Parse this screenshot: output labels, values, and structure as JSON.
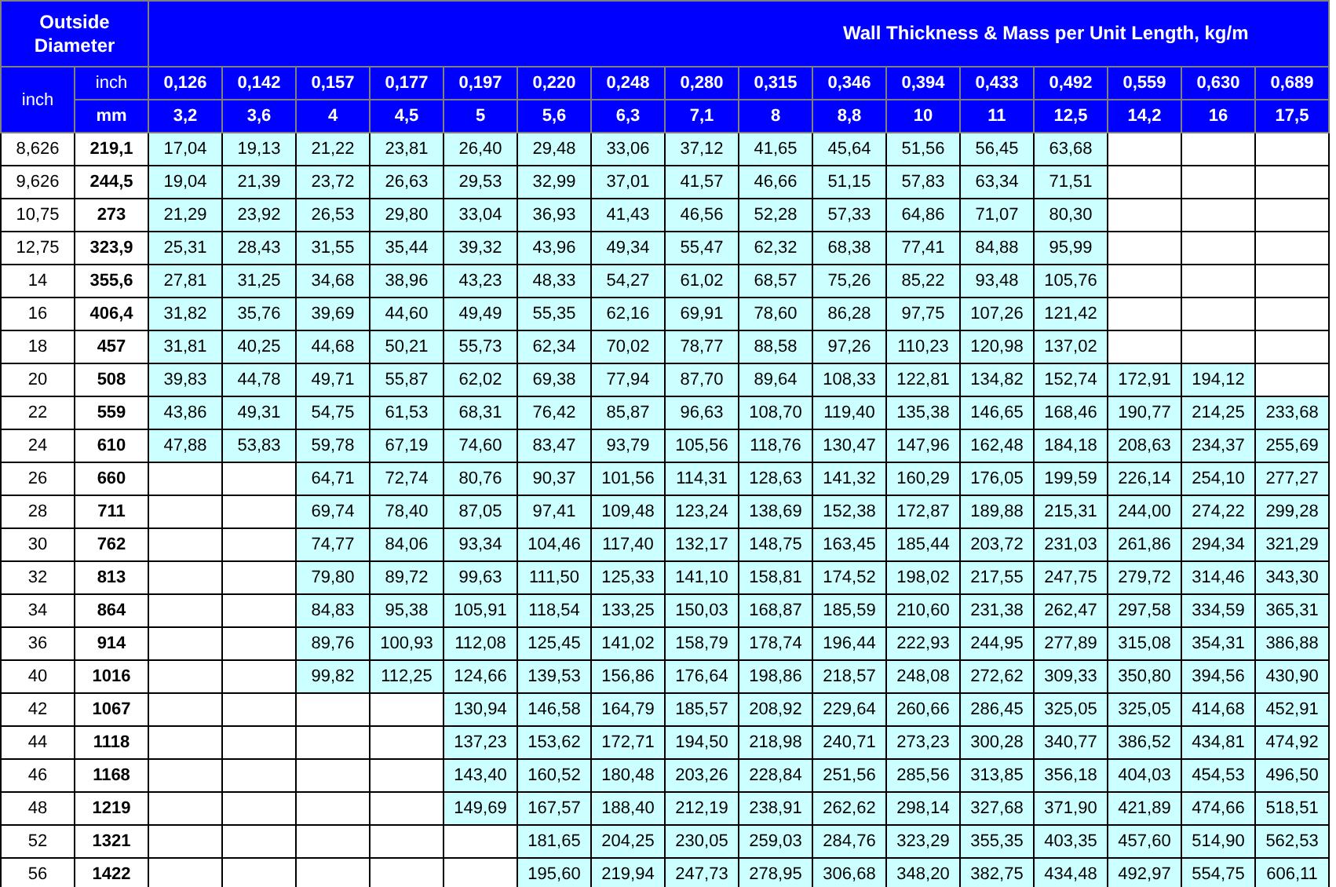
{
  "table": {
    "od_header": "Outside Diameter",
    "wt_header": "Wall Thickness & Mass per Unit Length, kg/m",
    "od_inch_label": "inch",
    "wt_inch_label": "inch",
    "wt_mm_label": "mm",
    "thicknesses": [
      {
        "inch": "0,126",
        "mm": "3,2"
      },
      {
        "inch": "0,142",
        "mm": "3,6"
      },
      {
        "inch": "0,157",
        "mm": "4"
      },
      {
        "inch": "0,177",
        "mm": "4,5"
      },
      {
        "inch": "0,197",
        "mm": "5"
      },
      {
        "inch": "0,220",
        "mm": "5,6"
      },
      {
        "inch": "0,248",
        "mm": "6,3"
      },
      {
        "inch": "0,280",
        "mm": "7,1"
      },
      {
        "inch": "0,315",
        "mm": "8"
      },
      {
        "inch": "0,346",
        "mm": "8,8"
      },
      {
        "inch": "0,394",
        "mm": "10"
      },
      {
        "inch": "0,433",
        "mm": "11"
      },
      {
        "inch": "0,492",
        "mm": "12,5"
      },
      {
        "inch": "0,559",
        "mm": "14,2"
      },
      {
        "inch": "0,630",
        "mm": "16"
      },
      {
        "inch": "0,689",
        "mm": "17,5"
      }
    ],
    "rows": [
      {
        "inch": "8,626",
        "mm": "219,1",
        "cells": [
          {
            "kind": "value",
            "text": "17,04"
          },
          {
            "kind": "value",
            "text": "19,13"
          },
          {
            "kind": "value",
            "text": "21,22"
          },
          {
            "kind": "value",
            "text": "23,81"
          },
          {
            "kind": "value",
            "text": "26,40"
          },
          {
            "kind": "value",
            "text": "29,48"
          },
          {
            "kind": "value",
            "text": "33,06"
          },
          {
            "kind": "value",
            "text": "37,12"
          },
          {
            "kind": "value",
            "text": "41,65"
          },
          {
            "kind": "value",
            "text": "45,64"
          },
          {
            "kind": "value",
            "text": "51,56"
          },
          {
            "kind": "value",
            "text": "56,45"
          },
          {
            "kind": "value",
            "text": "63,68"
          },
          {
            "kind": "blank"
          },
          {
            "kind": "blank"
          },
          {
            "kind": "blank"
          }
        ]
      },
      {
        "inch": "9,626",
        "mm": "244,5",
        "cells": [
          {
            "kind": "value",
            "text": "19,04"
          },
          {
            "kind": "value",
            "text": "21,39"
          },
          {
            "kind": "value",
            "text": "23,72"
          },
          {
            "kind": "value",
            "text": "26,63"
          },
          {
            "kind": "value",
            "text": "29,53"
          },
          {
            "kind": "value",
            "text": "32,99"
          },
          {
            "kind": "value",
            "text": "37,01"
          },
          {
            "kind": "value",
            "text": "41,57"
          },
          {
            "kind": "value",
            "text": "46,66"
          },
          {
            "kind": "value",
            "text": "51,15"
          },
          {
            "kind": "value",
            "text": "57,83"
          },
          {
            "kind": "value",
            "text": "63,34"
          },
          {
            "kind": "value",
            "text": "71,51"
          },
          {
            "kind": "blank"
          },
          {
            "kind": "blank"
          },
          {
            "kind": "blank"
          }
        ]
      },
      {
        "inch": "10,75",
        "mm": "273",
        "cells": [
          {
            "kind": "value",
            "text": "21,29"
          },
          {
            "kind": "value",
            "text": "23,92"
          },
          {
            "kind": "value",
            "text": "26,53"
          },
          {
            "kind": "value",
            "text": "29,80"
          },
          {
            "kind": "value",
            "text": "33,04"
          },
          {
            "kind": "value",
            "text": "36,93"
          },
          {
            "kind": "value",
            "text": "41,43"
          },
          {
            "kind": "value",
            "text": "46,56"
          },
          {
            "kind": "value",
            "text": "52,28"
          },
          {
            "kind": "value",
            "text": "57,33"
          },
          {
            "kind": "value",
            "text": "64,86"
          },
          {
            "kind": "value",
            "text": "71,07"
          },
          {
            "kind": "value",
            "text": "80,30"
          },
          {
            "kind": "blank"
          },
          {
            "kind": "blank"
          },
          {
            "kind": "blank"
          }
        ]
      },
      {
        "inch": "12,75",
        "mm": "323,9",
        "cells": [
          {
            "kind": "value",
            "text": "25,31"
          },
          {
            "kind": "value",
            "text": "28,43"
          },
          {
            "kind": "value",
            "text": "31,55"
          },
          {
            "kind": "value",
            "text": "35,44"
          },
          {
            "kind": "value",
            "text": "39,32"
          },
          {
            "kind": "value",
            "text": "43,96"
          },
          {
            "kind": "value",
            "text": "49,34"
          },
          {
            "kind": "value",
            "text": "55,47"
          },
          {
            "kind": "value",
            "text": "62,32"
          },
          {
            "kind": "value",
            "text": "68,38"
          },
          {
            "kind": "value",
            "text": "77,41"
          },
          {
            "kind": "value",
            "text": "84,88"
          },
          {
            "kind": "value",
            "text": "95,99"
          },
          {
            "kind": "blank"
          },
          {
            "kind": "blank"
          },
          {
            "kind": "blank"
          }
        ]
      },
      {
        "inch": "14",
        "mm": "355,6",
        "cells": [
          {
            "kind": "value",
            "text": "27,81"
          },
          {
            "kind": "value",
            "text": "31,25"
          },
          {
            "kind": "value",
            "text": "34,68"
          },
          {
            "kind": "value",
            "text": "38,96"
          },
          {
            "kind": "value",
            "text": "43,23"
          },
          {
            "kind": "value",
            "text": "48,33"
          },
          {
            "kind": "value",
            "text": "54,27"
          },
          {
            "kind": "value",
            "text": "61,02"
          },
          {
            "kind": "value",
            "text": "68,57"
          },
          {
            "kind": "value",
            "text": "75,26"
          },
          {
            "kind": "value",
            "text": "85,22"
          },
          {
            "kind": "value",
            "text": "93,48"
          },
          {
            "kind": "value",
            "text": "105,76"
          },
          {
            "kind": "blank"
          },
          {
            "kind": "blank"
          },
          {
            "kind": "blank"
          }
        ]
      },
      {
        "inch": "16",
        "mm": "406,4",
        "cells": [
          {
            "kind": "value",
            "text": "31,82"
          },
          {
            "kind": "value",
            "text": "35,76"
          },
          {
            "kind": "value",
            "text": "39,69"
          },
          {
            "kind": "value",
            "text": "44,60"
          },
          {
            "kind": "value",
            "text": "49,49"
          },
          {
            "kind": "value",
            "text": "55,35"
          },
          {
            "kind": "value",
            "text": "62,16"
          },
          {
            "kind": "value",
            "text": "69,91"
          },
          {
            "kind": "value",
            "text": "78,60"
          },
          {
            "kind": "value",
            "text": "86,28"
          },
          {
            "kind": "value",
            "text": "97,75"
          },
          {
            "kind": "value",
            "text": "107,26"
          },
          {
            "kind": "value",
            "text": "121,42"
          },
          {
            "kind": "blank"
          },
          {
            "kind": "blank"
          },
          {
            "kind": "blank"
          }
        ]
      },
      {
        "inch": "18",
        "mm": "457",
        "cells": [
          {
            "kind": "value",
            "text": "31,81"
          },
          {
            "kind": "value",
            "text": "40,25"
          },
          {
            "kind": "value",
            "text": "44,68"
          },
          {
            "kind": "value",
            "text": "50,21"
          },
          {
            "kind": "value",
            "text": "55,73"
          },
          {
            "kind": "value",
            "text": "62,34"
          },
          {
            "kind": "value",
            "text": "70,02"
          },
          {
            "kind": "value",
            "text": "78,77"
          },
          {
            "kind": "value",
            "text": "88,58"
          },
          {
            "kind": "value",
            "text": "97,26"
          },
          {
            "kind": "value",
            "text": "110,23"
          },
          {
            "kind": "value",
            "text": "120,98"
          },
          {
            "kind": "value",
            "text": "137,02"
          },
          {
            "kind": "blank"
          },
          {
            "kind": "blank"
          },
          {
            "kind": "blank"
          }
        ]
      },
      {
        "inch": "20",
        "mm": "508",
        "cells": [
          {
            "kind": "value",
            "text": "39,83"
          },
          {
            "kind": "value",
            "text": "44,78"
          },
          {
            "kind": "value",
            "text": "49,71"
          },
          {
            "kind": "value",
            "text": "55,87"
          },
          {
            "kind": "value",
            "text": "62,02"
          },
          {
            "kind": "value",
            "text": "69,38"
          },
          {
            "kind": "value",
            "text": "77,94"
          },
          {
            "kind": "value",
            "text": "87,70"
          },
          {
            "kind": "value",
            "text": "89,64"
          },
          {
            "kind": "value",
            "text": "108,33"
          },
          {
            "kind": "value",
            "text": "122,81"
          },
          {
            "kind": "value",
            "text": "134,82"
          },
          {
            "kind": "value",
            "text": "152,74"
          },
          {
            "kind": "value",
            "text": "172,91"
          },
          {
            "kind": "value",
            "text": "194,12"
          },
          {
            "kind": "blank"
          }
        ]
      },
      {
        "inch": "22",
        "mm": "559",
        "cells": [
          {
            "kind": "value",
            "text": "43,86"
          },
          {
            "kind": "value",
            "text": "49,31"
          },
          {
            "kind": "value",
            "text": "54,75"
          },
          {
            "kind": "value",
            "text": "61,53"
          },
          {
            "kind": "value",
            "text": "68,31"
          },
          {
            "kind": "value",
            "text": "76,42"
          },
          {
            "kind": "value",
            "text": "85,87"
          },
          {
            "kind": "value",
            "text": "96,63"
          },
          {
            "kind": "value",
            "text": "108,70"
          },
          {
            "kind": "value",
            "text": "119,40"
          },
          {
            "kind": "value",
            "text": "135,38"
          },
          {
            "kind": "value",
            "text": "146,65"
          },
          {
            "kind": "value",
            "text": "168,46"
          },
          {
            "kind": "value",
            "text": "190,77"
          },
          {
            "kind": "value",
            "text": "214,25"
          },
          {
            "kind": "value",
            "text": "233,68"
          }
        ]
      },
      {
        "inch": "24",
        "mm": "610",
        "cells": [
          {
            "kind": "value",
            "text": "47,88"
          },
          {
            "kind": "value",
            "text": "53,83"
          },
          {
            "kind": "value",
            "text": "59,78"
          },
          {
            "kind": "value",
            "text": "67,19"
          },
          {
            "kind": "value",
            "text": "74,60"
          },
          {
            "kind": "value",
            "text": "83,47"
          },
          {
            "kind": "value",
            "text": "93,79"
          },
          {
            "kind": "value",
            "text": "105,56"
          },
          {
            "kind": "value",
            "text": "118,76"
          },
          {
            "kind": "value",
            "text": "130,47"
          },
          {
            "kind": "value",
            "text": "147,96"
          },
          {
            "kind": "value",
            "text": "162,48"
          },
          {
            "kind": "value",
            "text": "184,18"
          },
          {
            "kind": "value",
            "text": "208,63"
          },
          {
            "kind": "value",
            "text": "234,37"
          },
          {
            "kind": "value",
            "text": "255,69"
          }
        ]
      },
      {
        "inch": "26",
        "mm": "660",
        "cells": [
          {
            "kind": "blank"
          },
          {
            "kind": "blank"
          },
          {
            "kind": "value",
            "text": "64,71"
          },
          {
            "kind": "value",
            "text": "72,74"
          },
          {
            "kind": "value",
            "text": "80,76"
          },
          {
            "kind": "value",
            "text": "90,37"
          },
          {
            "kind": "value",
            "text": "101,56"
          },
          {
            "kind": "value",
            "text": "114,31"
          },
          {
            "kind": "value",
            "text": "128,63"
          },
          {
            "kind": "value",
            "text": "141,32"
          },
          {
            "kind": "value",
            "text": "160,29"
          },
          {
            "kind": "value",
            "text": "176,05"
          },
          {
            "kind": "value",
            "text": "199,59"
          },
          {
            "kind": "value",
            "text": "226,14"
          },
          {
            "kind": "value",
            "text": "254,10"
          },
          {
            "kind": "value",
            "text": "277,27"
          }
        ]
      },
      {
        "inch": "28",
        "mm": "711",
        "cells": [
          {
            "kind": "blank"
          },
          {
            "kind": "blank"
          },
          {
            "kind": "value",
            "text": "69,74"
          },
          {
            "kind": "value",
            "text": "78,40"
          },
          {
            "kind": "value",
            "text": "87,05"
          },
          {
            "kind": "value",
            "text": "97,41"
          },
          {
            "kind": "value",
            "text": "109,48"
          },
          {
            "kind": "value",
            "text": "123,24"
          },
          {
            "kind": "value",
            "text": "138,69"
          },
          {
            "kind": "value",
            "text": "152,38"
          },
          {
            "kind": "value",
            "text": "172,87"
          },
          {
            "kind": "value",
            "text": "189,88"
          },
          {
            "kind": "value",
            "text": "215,31"
          },
          {
            "kind": "value",
            "text": "244,00"
          },
          {
            "kind": "value",
            "text": "274,22"
          },
          {
            "kind": "value",
            "text": "299,28"
          }
        ]
      },
      {
        "inch": "30",
        "mm": "762",
        "cells": [
          {
            "kind": "blank"
          },
          {
            "kind": "blank"
          },
          {
            "kind": "value",
            "text": "74,77"
          },
          {
            "kind": "value",
            "text": "84,06"
          },
          {
            "kind": "value",
            "text": "93,34"
          },
          {
            "kind": "value",
            "text": "104,46"
          },
          {
            "kind": "value",
            "text": "117,40"
          },
          {
            "kind": "value",
            "text": "132,17"
          },
          {
            "kind": "value",
            "text": "148,75"
          },
          {
            "kind": "value",
            "text": "163,45"
          },
          {
            "kind": "value",
            "text": "185,44"
          },
          {
            "kind": "value",
            "text": "203,72"
          },
          {
            "kind": "value",
            "text": "231,03"
          },
          {
            "kind": "value",
            "text": "261,86"
          },
          {
            "kind": "value",
            "text": "294,34"
          },
          {
            "kind": "value",
            "text": "321,29"
          }
        ]
      },
      {
        "inch": "32",
        "mm": "813",
        "cells": [
          {
            "kind": "blank"
          },
          {
            "kind": "blank"
          },
          {
            "kind": "value",
            "text": "79,80"
          },
          {
            "kind": "value",
            "text": "89,72"
          },
          {
            "kind": "value",
            "text": "99,63"
          },
          {
            "kind": "value",
            "text": "111,50"
          },
          {
            "kind": "value",
            "text": "125,33"
          },
          {
            "kind": "value",
            "text": "141,10"
          },
          {
            "kind": "value",
            "text": "158,81"
          },
          {
            "kind": "value",
            "text": "174,52"
          },
          {
            "kind": "value",
            "text": "198,02"
          },
          {
            "kind": "value",
            "text": "217,55"
          },
          {
            "kind": "value",
            "text": "247,75"
          },
          {
            "kind": "value",
            "text": "279,72"
          },
          {
            "kind": "value",
            "text": "314,46"
          },
          {
            "kind": "value",
            "text": "343,30"
          }
        ]
      },
      {
        "inch": "34",
        "mm": "864",
        "cells": [
          {
            "kind": "blank"
          },
          {
            "kind": "blank"
          },
          {
            "kind": "value",
            "text": "84,83"
          },
          {
            "kind": "value",
            "text": "95,38"
          },
          {
            "kind": "value",
            "text": "105,91"
          },
          {
            "kind": "value",
            "text": "118,54"
          },
          {
            "kind": "value",
            "text": "133,25"
          },
          {
            "kind": "value",
            "text": "150,03"
          },
          {
            "kind": "value",
            "text": "168,87"
          },
          {
            "kind": "value",
            "text": "185,59"
          },
          {
            "kind": "value",
            "text": "210,60"
          },
          {
            "kind": "value",
            "text": "231,38"
          },
          {
            "kind": "value",
            "text": "262,47"
          },
          {
            "kind": "value",
            "text": "297,58"
          },
          {
            "kind": "value",
            "text": "334,59"
          },
          {
            "kind": "value",
            "text": "365,31"
          }
        ]
      },
      {
        "inch": "36",
        "mm": "914",
        "cells": [
          {
            "kind": "blank"
          },
          {
            "kind": "blank"
          },
          {
            "kind": "value",
            "text": "89,76"
          },
          {
            "kind": "value",
            "text": "100,93"
          },
          {
            "kind": "value",
            "text": "112,08"
          },
          {
            "kind": "value",
            "text": "125,45"
          },
          {
            "kind": "value",
            "text": "141,02"
          },
          {
            "kind": "value",
            "text": "158,79"
          },
          {
            "kind": "value",
            "text": "178,74"
          },
          {
            "kind": "value",
            "text": "196,44"
          },
          {
            "kind": "value",
            "text": "222,93"
          },
          {
            "kind": "value",
            "text": "244,95"
          },
          {
            "kind": "value",
            "text": "277,89"
          },
          {
            "kind": "value",
            "text": "315,08"
          },
          {
            "kind": "value",
            "text": "354,31"
          },
          {
            "kind": "value",
            "text": "386,88"
          }
        ]
      },
      {
        "inch": "40",
        "mm": "1016",
        "cells": [
          {
            "kind": "blank"
          },
          {
            "kind": "blank"
          },
          {
            "kind": "value",
            "text": "99,82"
          },
          {
            "kind": "value",
            "text": "112,25"
          },
          {
            "kind": "value",
            "text": "124,66"
          },
          {
            "kind": "value",
            "text": "139,53"
          },
          {
            "kind": "value",
            "text": "156,86"
          },
          {
            "kind": "value",
            "text": "176,64"
          },
          {
            "kind": "value",
            "text": "198,86"
          },
          {
            "kind": "value",
            "text": "218,57"
          },
          {
            "kind": "value",
            "text": "248,08"
          },
          {
            "kind": "value",
            "text": "272,62"
          },
          {
            "kind": "value",
            "text": "309,33"
          },
          {
            "kind": "value",
            "text": "350,80"
          },
          {
            "kind": "value",
            "text": "394,56"
          },
          {
            "kind": "value",
            "text": "430,90"
          }
        ]
      },
      {
        "inch": "42",
        "mm": "1067",
        "cells": [
          {
            "kind": "blank"
          },
          {
            "kind": "blank"
          },
          {
            "kind": "blank"
          },
          {
            "kind": "blank"
          },
          {
            "kind": "value",
            "text": "130,94"
          },
          {
            "kind": "value",
            "text": "146,58"
          },
          {
            "kind": "value",
            "text": "164,79"
          },
          {
            "kind": "value",
            "text": "185,57"
          },
          {
            "kind": "value",
            "text": "208,92"
          },
          {
            "kind": "value",
            "text": "229,64"
          },
          {
            "kind": "value",
            "text": "260,66"
          },
          {
            "kind": "value",
            "text": "286,45"
          },
          {
            "kind": "value",
            "text": "325,05"
          },
          {
            "kind": "value",
            "text": "325,05"
          },
          {
            "kind": "value",
            "text": "414,68"
          },
          {
            "kind": "value",
            "text": "452,91"
          }
        ]
      },
      {
        "inch": "44",
        "mm": "1118",
        "cells": [
          {
            "kind": "blank"
          },
          {
            "kind": "blank"
          },
          {
            "kind": "blank"
          },
          {
            "kind": "blank"
          },
          {
            "kind": "value",
            "text": "137,23"
          },
          {
            "kind": "value",
            "text": "153,62"
          },
          {
            "kind": "value",
            "text": "172,71"
          },
          {
            "kind": "value",
            "text": "194,50"
          },
          {
            "kind": "value",
            "text": "218,98"
          },
          {
            "kind": "value",
            "text": "240,71"
          },
          {
            "kind": "value",
            "text": "273,23"
          },
          {
            "kind": "value",
            "text": "300,28"
          },
          {
            "kind": "value",
            "text": "340,77"
          },
          {
            "kind": "value",
            "text": "386,52"
          },
          {
            "kind": "value",
            "text": "434,81"
          },
          {
            "kind": "value",
            "text": "474,92"
          }
        ]
      },
      {
        "inch": "46",
        "mm": "1168",
        "cells": [
          {
            "kind": "blank"
          },
          {
            "kind": "blank"
          },
          {
            "kind": "blank"
          },
          {
            "kind": "blank"
          },
          {
            "kind": "value",
            "text": "143,40"
          },
          {
            "kind": "value",
            "text": "160,52"
          },
          {
            "kind": "value",
            "text": "180,48"
          },
          {
            "kind": "value",
            "text": "203,26"
          },
          {
            "kind": "value",
            "text": "228,84"
          },
          {
            "kind": "value",
            "text": "251,56"
          },
          {
            "kind": "value",
            "text": "285,56"
          },
          {
            "kind": "value",
            "text": "313,85"
          },
          {
            "kind": "value",
            "text": "356,18"
          },
          {
            "kind": "value",
            "text": "404,03"
          },
          {
            "kind": "value",
            "text": "454,53"
          },
          {
            "kind": "value",
            "text": "496,50"
          }
        ]
      },
      {
        "inch": "48",
        "mm": "1219",
        "cells": [
          {
            "kind": "blank"
          },
          {
            "kind": "blank"
          },
          {
            "kind": "blank"
          },
          {
            "kind": "blank"
          },
          {
            "kind": "value",
            "text": "149,69"
          },
          {
            "kind": "value",
            "text": "167,57"
          },
          {
            "kind": "value",
            "text": "188,40"
          },
          {
            "kind": "value",
            "text": "212,19"
          },
          {
            "kind": "value",
            "text": "238,91"
          },
          {
            "kind": "value",
            "text": "262,62"
          },
          {
            "kind": "value",
            "text": "298,14"
          },
          {
            "kind": "value",
            "text": "327,68"
          },
          {
            "kind": "value",
            "text": "371,90"
          },
          {
            "kind": "value",
            "text": "421,89"
          },
          {
            "kind": "value",
            "text": "474,66"
          },
          {
            "kind": "value",
            "text": "518,51"
          }
        ]
      },
      {
        "inch": "52",
        "mm": "1321",
        "cells": [
          {
            "kind": "blank"
          },
          {
            "kind": "blank"
          },
          {
            "kind": "blank"
          },
          {
            "kind": "blank"
          },
          {
            "kind": "blank"
          },
          {
            "kind": "value",
            "text": "181,65"
          },
          {
            "kind": "value",
            "text": "204,25"
          },
          {
            "kind": "value",
            "text": "230,05"
          },
          {
            "kind": "value",
            "text": "259,03"
          },
          {
            "kind": "value",
            "text": "284,76"
          },
          {
            "kind": "value",
            "text": "323,29"
          },
          {
            "kind": "value",
            "text": "355,35"
          },
          {
            "kind": "value",
            "text": "403,35"
          },
          {
            "kind": "value",
            "text": "457,60"
          },
          {
            "kind": "value",
            "text": "514,90"
          },
          {
            "kind": "value",
            "text": "562,53"
          }
        ]
      },
      {
        "inch": "56",
        "mm": "1422",
        "cells": [
          {
            "kind": "blank"
          },
          {
            "kind": "blank"
          },
          {
            "kind": "blank"
          },
          {
            "kind": "blank"
          },
          {
            "kind": "blank"
          },
          {
            "kind": "value",
            "text": "195,60"
          },
          {
            "kind": "value",
            "text": "219,94"
          },
          {
            "kind": "value",
            "text": "247,73"
          },
          {
            "kind": "value",
            "text": "278,95"
          },
          {
            "kind": "value",
            "text": "306,68"
          },
          {
            "kind": "value",
            "text": "348,20"
          },
          {
            "kind": "value",
            "text": "382,75"
          },
          {
            "kind": "value",
            "text": "434,48"
          },
          {
            "kind": "value",
            "text": "492,97"
          },
          {
            "kind": "value",
            "text": "554,75"
          },
          {
            "kind": "value",
            "text": "606,11"
          }
        ]
      }
    ]
  }
}
